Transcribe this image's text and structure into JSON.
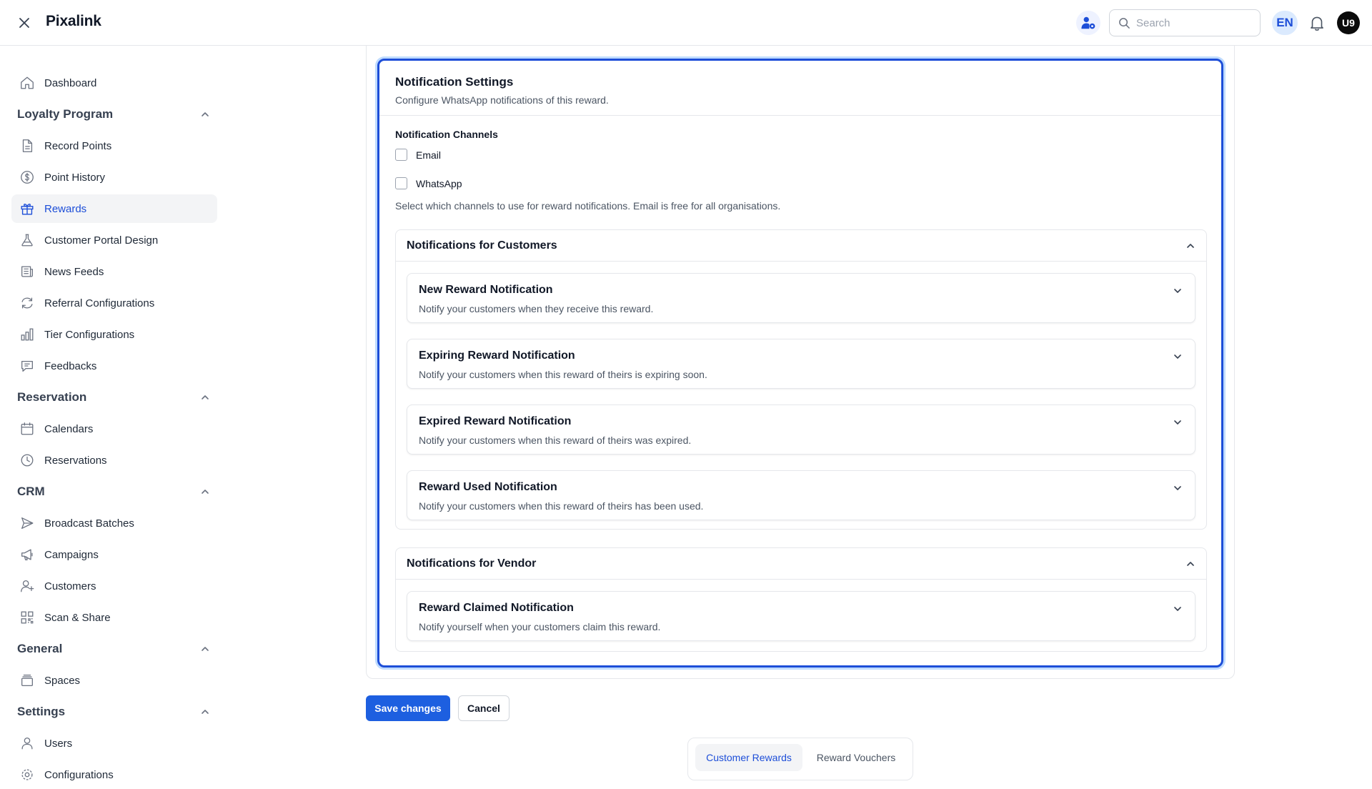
{
  "app": {
    "title": "Pixalink"
  },
  "header": {
    "search_placeholder": "Search",
    "language": "EN",
    "user_initials": "U9"
  },
  "sidebar": {
    "dashboard": "Dashboard",
    "sections": {
      "loyalty": "Loyalty Program",
      "reservation": "Reservation",
      "crm": "CRM",
      "general": "General",
      "settings": "Settings"
    },
    "loyalty_items": [
      "Record Points",
      "Point History",
      "Rewards",
      "Customer Portal Design",
      "News Feeds",
      "Referral Configurations",
      "Tier Configurations",
      "Feedbacks"
    ],
    "reservation_items": [
      "Calendars",
      "Reservations"
    ],
    "crm_items": [
      "Broadcast Batches",
      "Campaigns",
      "Customers",
      "Scan & Share"
    ],
    "general_items": [
      "Spaces"
    ],
    "settings_items": [
      "Users",
      "Configurations"
    ],
    "active_item": "Rewards"
  },
  "notification_settings": {
    "title": "Notification Settings",
    "subtitle": "Configure WhatsApp notifications of this reward.",
    "channels_label": "Notification Channels",
    "channels": [
      {
        "label": "Email",
        "checked": false
      },
      {
        "label": "WhatsApp",
        "checked": false
      }
    ],
    "channels_help": "Select which channels to use for reward notifications. Email is free for all organisations.",
    "customer_group": {
      "title": "Notifications for Customers",
      "items": [
        {
          "title": "New Reward Notification",
          "desc": "Notify your customers when they receive this reward."
        },
        {
          "title": "Expiring Reward Notification",
          "desc": "Notify your customers when this reward of theirs is expiring soon."
        },
        {
          "title": "Expired Reward Notification",
          "desc": "Notify your customers when this reward of theirs was expired."
        },
        {
          "title": "Reward Used Notification",
          "desc": "Notify your customers when this reward of theirs has been used."
        }
      ]
    },
    "vendor_group": {
      "title": "Notifications for Vendor",
      "items": [
        {
          "title": "Reward Claimed Notification",
          "desc": "Notify yourself when your customers claim this reward."
        }
      ]
    }
  },
  "actions": {
    "save": "Save changes",
    "cancel": "Cancel"
  },
  "bottom_tabs": [
    {
      "label": "Customer Rewards",
      "active": true
    },
    {
      "label": "Reward Vouchers",
      "active": false
    }
  ],
  "colors": {
    "accent": "#1d4ed8",
    "primary_button": "#1d5fe0"
  }
}
